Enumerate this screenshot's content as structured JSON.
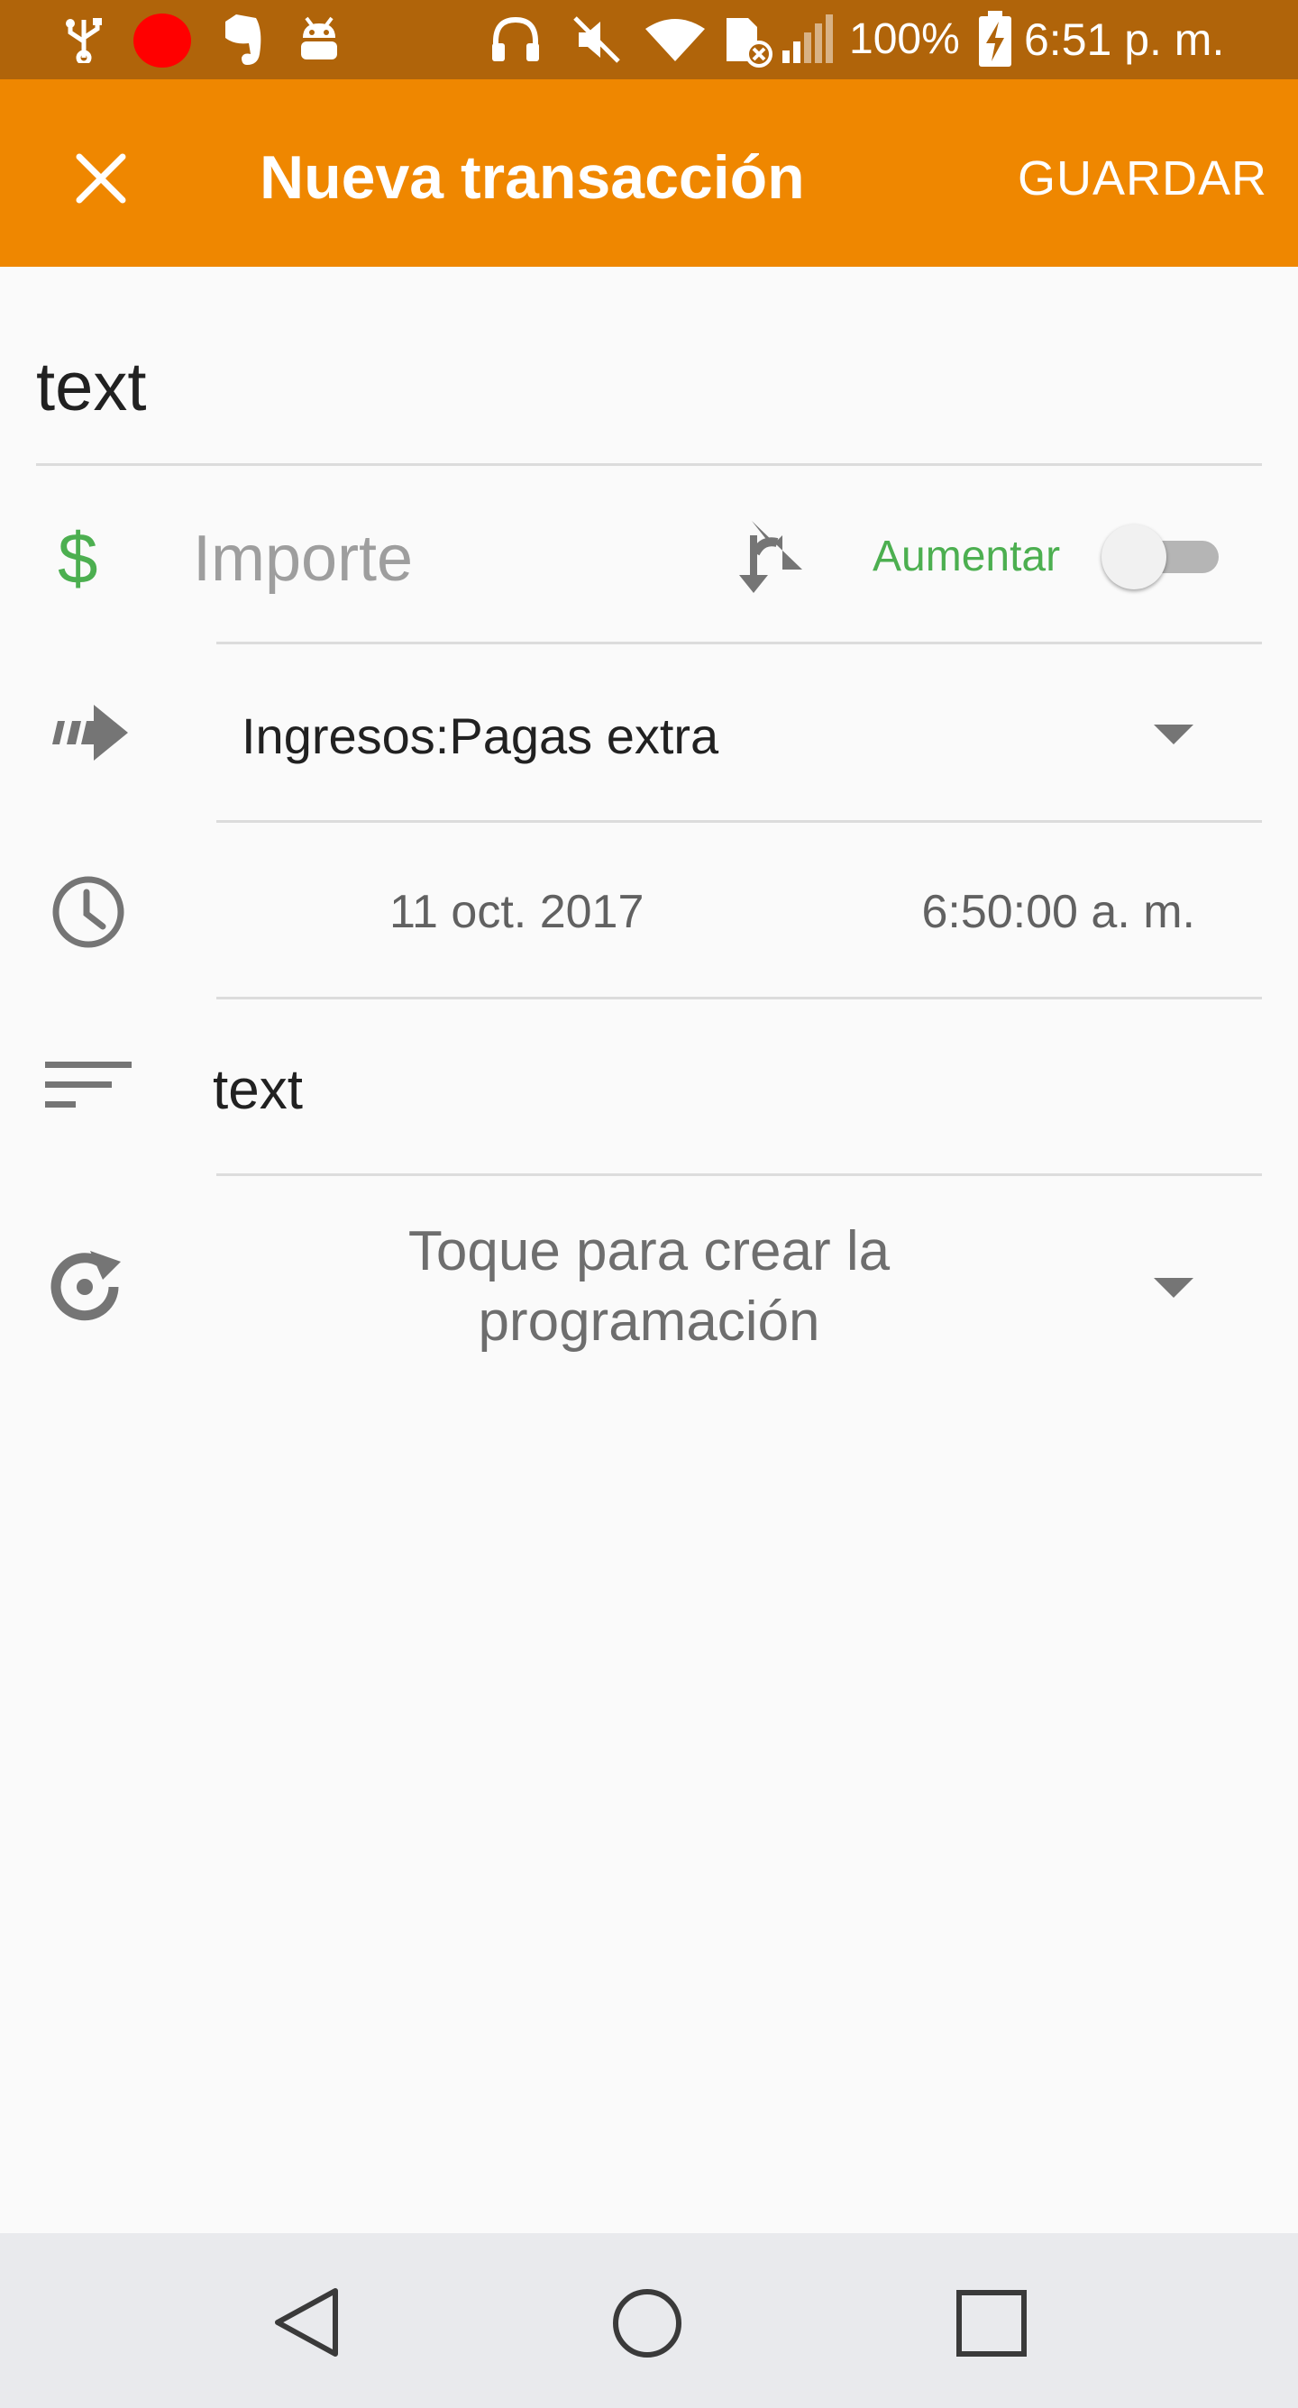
{
  "status_bar": {
    "battery": "100%",
    "time": "6:51 p. m.",
    "icons": [
      "usb-icon",
      "recording-dot-icon",
      "evernote-icon",
      "android-debug-icon",
      "headphones-icon",
      "mute-icon",
      "wifi-icon",
      "no-sim-icon",
      "signal-icon",
      "battery-charging-icon"
    ]
  },
  "app_bar": {
    "title": "Nueva transacción",
    "save_label": "GUARDAR",
    "close_icon": "close-icon"
  },
  "form": {
    "description_value": "text",
    "amount": {
      "placeholder": "Importe",
      "currency_symbol": "$",
      "toggle_label": "Aumentar",
      "toggle_on": false,
      "accent_color": "#4caf50"
    },
    "account": {
      "selected": "Ingresos:Pagas extra"
    },
    "datetime": {
      "date": "11 oct. 2017",
      "time": "6:50:00 a. m."
    },
    "notes_value": "text",
    "recurrence": {
      "text_line1": "Toque para crear la",
      "text_line2": "programación"
    }
  },
  "colors": {
    "status_bar": "#b0640a",
    "app_bar": "#ef8700",
    "background": "#fafafa",
    "icon_gray": "#757575"
  }
}
